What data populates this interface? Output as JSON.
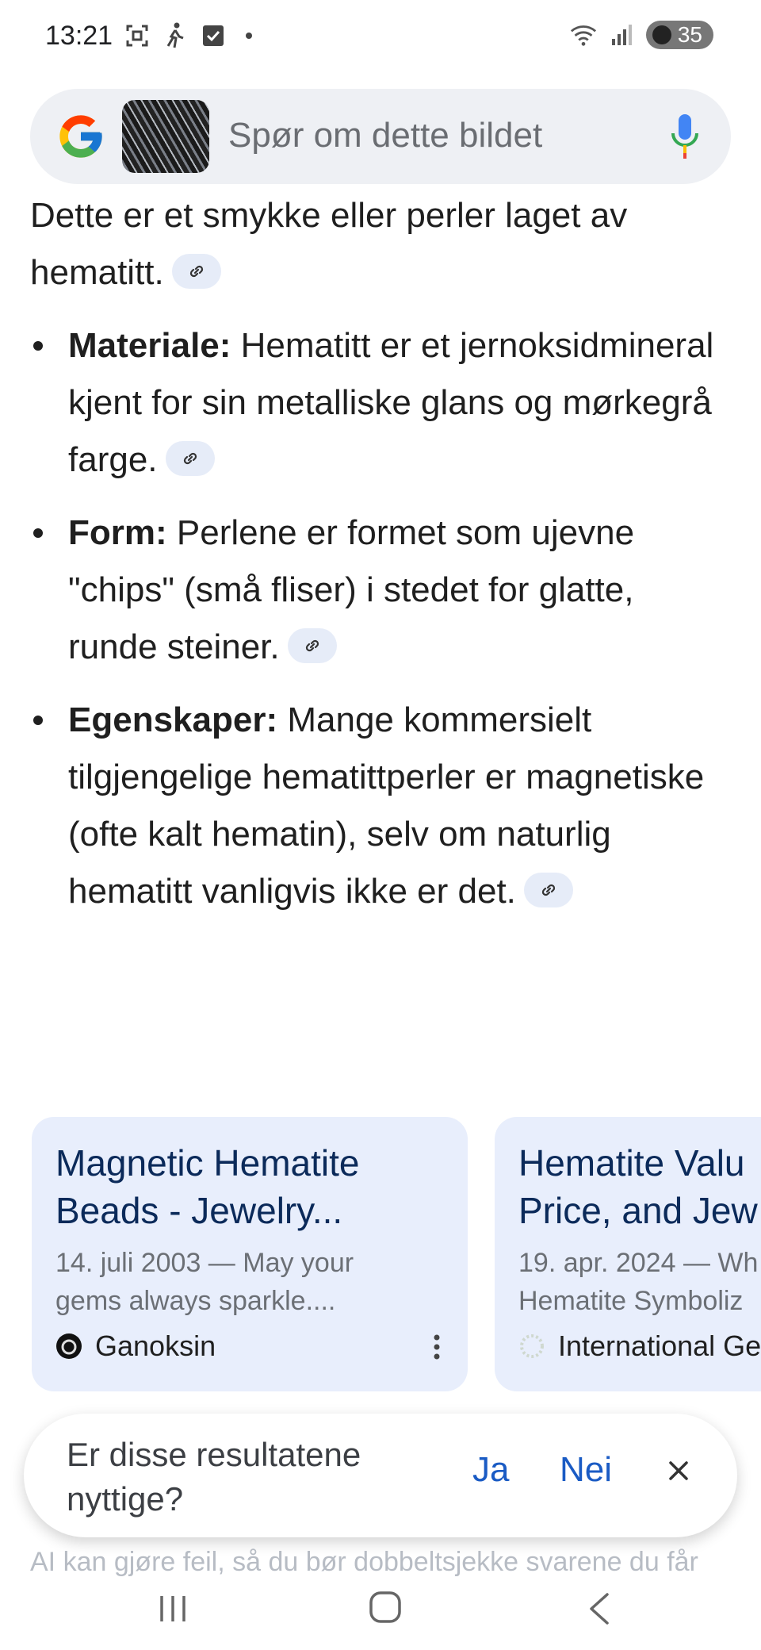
{
  "status_bar": {
    "time": "13:21",
    "battery": "35"
  },
  "search": {
    "placeholder": "Spør om dette bildet"
  },
  "answer": {
    "intro": "Dette er et smykke eller perler laget av hematitt.",
    "bullets": [
      {
        "title": "Materiale:",
        "text": "Hematitt er et jernoksidmineral kjent for sin metalliske glans og mørkegrå farge."
      },
      {
        "title": "Form:",
        "text": "Perlene er formet som ujevne \"chips\" (små fliser) i stedet for glatte, runde steiner."
      },
      {
        "title": "Egenskaper:",
        "text": "Mange kommersielt tilgjengelige hematittperler er magnetiske (ofte kalt hematin), selv om naturlig hematitt vanligvis ikke er det."
      }
    ]
  },
  "cards": [
    {
      "title_line1": "Magnetic Hematite",
      "title_line2": "Beads - Jewelry...",
      "snippet_line1": "14. juli 2003 — May your",
      "snippet_line2": "gems always sparkle....",
      "source": "Ganoksin"
    },
    {
      "title_line1": "Hematite Valu",
      "title_line2": "Price, and Jew",
      "snippet_line1": "19. apr. 2024 — Wh",
      "snippet_line2": "Hematite Symboliz",
      "source": "International Ge"
    }
  ],
  "feedback": {
    "question": "Er disse resultatene nyttige?",
    "yes": "Ja",
    "no": "Nei"
  },
  "disclaimer": "AI kan gjøre feil, så du bør dobbeltsjekke svarene du får",
  "colors": {
    "accent": "#1a5bc4",
    "card_bg": "#e8eefc",
    "search_bg": "#eef0f4"
  }
}
